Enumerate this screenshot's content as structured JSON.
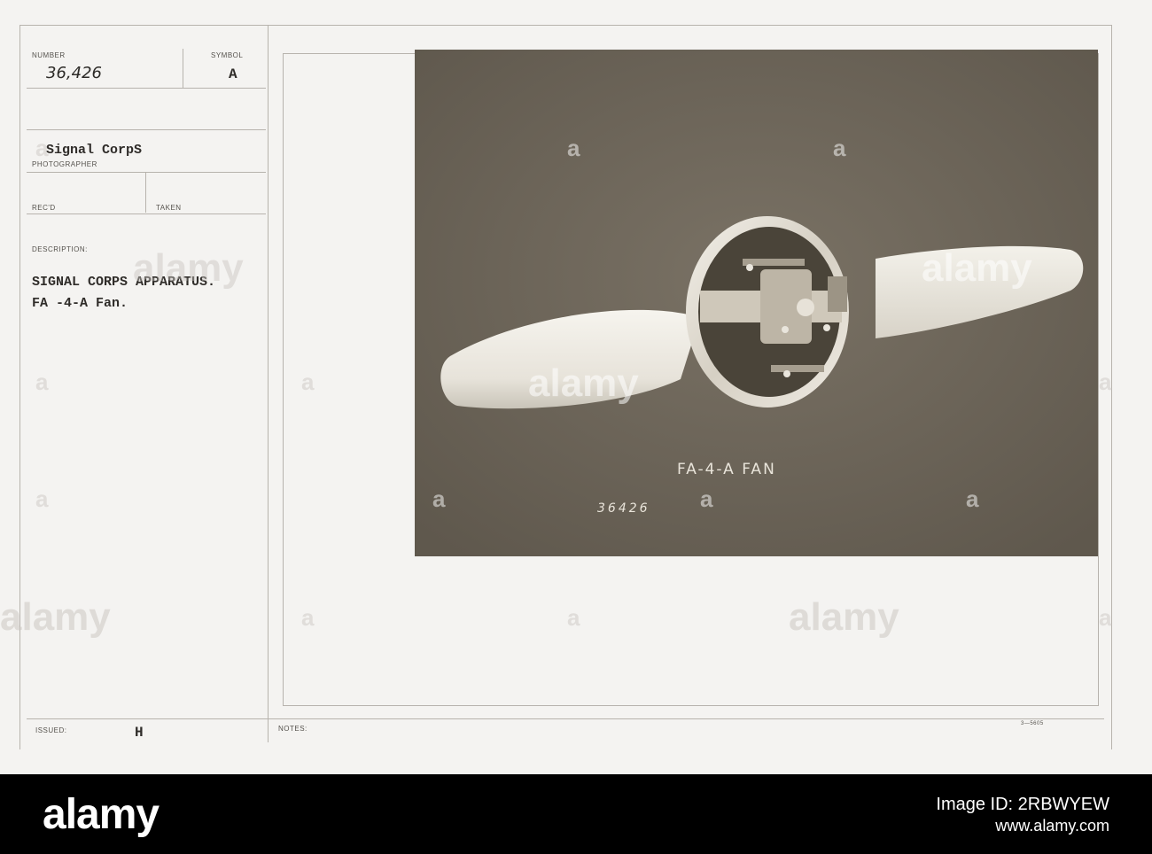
{
  "card": {
    "number_label": "NUMBER",
    "number_value": "36,426",
    "symbol_label": "SYMBOL",
    "symbol_value": "A",
    "photographer_value": "Signal CorpS",
    "photographer_label": "PHOTOGRAPHER",
    "recd_label": "REC'D",
    "taken_label": "TAKEN",
    "description_label": "DESCRIPTION:",
    "description_line1": "SIGNAL CORPS APPARATUS.",
    "description_line2": "FA -4-A Fan.",
    "issued_label": "ISSUED:",
    "issued_value": "H",
    "notes_label": "NOTES:",
    "form_number": "3—5605"
  },
  "photo": {
    "caption": "FA-4-A FAN",
    "negative_number": "36426"
  },
  "watermark": {
    "text": "alamy",
    "glyph": "a"
  },
  "footer": {
    "logo": "alamy",
    "image_id": "Image ID: 2RBWYEW",
    "site": "www.alamy.com"
  }
}
